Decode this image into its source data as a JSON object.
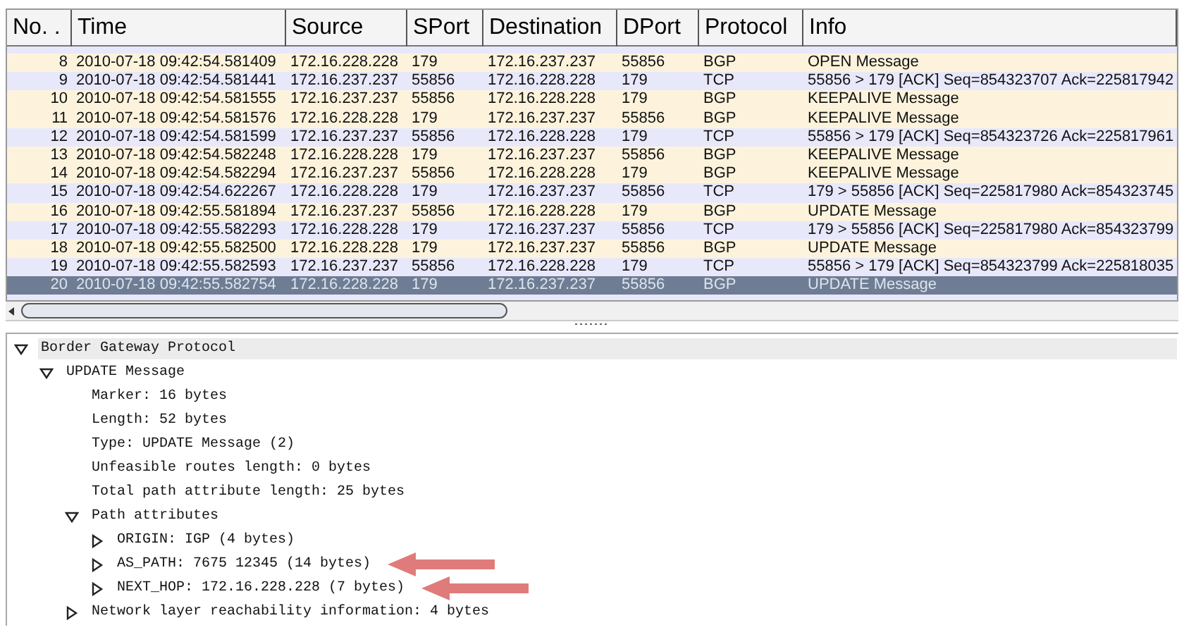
{
  "packet_list": {
    "columns": [
      "No. .",
      "Time",
      "Source",
      "SPort",
      "Destination",
      "DPort",
      "Protocol",
      "Info"
    ],
    "rows": [
      {
        "cells": [
          "8",
          "2010-07-18 09:42:54.581409",
          "172.16.228.228",
          "179",
          "172.16.237.237",
          "55856",
          "BGP",
          "OPEN Message"
        ],
        "color": "#fdf3dc",
        "selected": false
      },
      {
        "cells": [
          "9",
          "2010-07-18 09:42:54.581441",
          "172.16.237.237",
          "55856",
          "172.16.228.228",
          "179",
          "TCP",
          "55856 > 179 [ACK] Seq=854323707 Ack=225817942"
        ],
        "color": "#e8e8fb",
        "selected": false
      },
      {
        "cells": [
          "10",
          "2010-07-18 09:42:54.581555",
          "172.16.237.237",
          "55856",
          "172.16.228.228",
          "179",
          "BGP",
          "KEEPALIVE Message"
        ],
        "color": "#fdf3dc",
        "selected": false
      },
      {
        "cells": [
          "11",
          "2010-07-18 09:42:54.581576",
          "172.16.228.228",
          "179",
          "172.16.237.237",
          "55856",
          "BGP",
          "KEEPALIVE Message"
        ],
        "color": "#fdf3dc",
        "selected": false
      },
      {
        "cells": [
          "12",
          "2010-07-18 09:42:54.581599",
          "172.16.237.237",
          "55856",
          "172.16.228.228",
          "179",
          "TCP",
          "55856 > 179 [ACK] Seq=854323726 Ack=225817961"
        ],
        "color": "#e8e8fb",
        "selected": false
      },
      {
        "cells": [
          "13",
          "2010-07-18 09:42:54.582248",
          "172.16.228.228",
          "179",
          "172.16.237.237",
          "55856",
          "BGP",
          "KEEPALIVE Message"
        ],
        "color": "#fdf3dc",
        "selected": false
      },
      {
        "cells": [
          "14",
          "2010-07-18 09:42:54.582294",
          "172.16.237.237",
          "55856",
          "172.16.228.228",
          "179",
          "BGP",
          "KEEPALIVE Message"
        ],
        "color": "#fdf3dc",
        "selected": false
      },
      {
        "cells": [
          "15",
          "2010-07-18 09:42:54.622267",
          "172.16.228.228",
          "179",
          "172.16.237.237",
          "55856",
          "TCP",
          "179 > 55856 [ACK] Seq=225817980 Ack=854323745"
        ],
        "color": "#e8e8fb",
        "selected": false
      },
      {
        "cells": [
          "16",
          "2010-07-18 09:42:55.581894",
          "172.16.237.237",
          "55856",
          "172.16.228.228",
          "179",
          "BGP",
          "UPDATE Message"
        ],
        "color": "#fdf3dc",
        "selected": false
      },
      {
        "cells": [
          "17",
          "2010-07-18 09:42:55.582293",
          "172.16.228.228",
          "179",
          "172.16.237.237",
          "55856",
          "TCP",
          "179 > 55856 [ACK] Seq=225817980 Ack=854323799"
        ],
        "color": "#e8e8fb",
        "selected": false
      },
      {
        "cells": [
          "18",
          "2010-07-18 09:42:55.582500",
          "172.16.228.228",
          "179",
          "172.16.237.237",
          "55856",
          "BGP",
          "UPDATE Message"
        ],
        "color": "#fdf3dc",
        "selected": false
      },
      {
        "cells": [
          "19",
          "2010-07-18 09:42:55.582593",
          "172.16.237.237",
          "55856",
          "172.16.228.228",
          "179",
          "TCP",
          "55856 > 179 [ACK] Seq=854323799 Ack=225818035"
        ],
        "color": "#e8e8fb",
        "selected": false
      },
      {
        "cells": [
          "20",
          "2010-07-18 09:42:55.582754",
          "172.16.228.228",
          "179",
          "172.16.237.237",
          "55856",
          "BGP",
          "UPDATE Message"
        ],
        "color": "#6e7d93",
        "selected": true
      }
    ]
  },
  "packet_details": [
    {
      "label": "Border Gateway Protocol",
      "kind": "branch",
      "expanded": true,
      "selected": true,
      "highlighted": false,
      "children": [
        {
          "label": "UPDATE Message",
          "kind": "branch",
          "expanded": true,
          "selected": false,
          "highlighted": false,
          "children": [
            {
              "label": "Marker: 16 bytes",
              "kind": "leaf",
              "selected": false,
              "highlighted": false
            },
            {
              "label": "Length: 52 bytes",
              "kind": "leaf",
              "selected": false,
              "highlighted": false
            },
            {
              "label": "Type: UPDATE Message (2)",
              "kind": "leaf",
              "selected": false,
              "highlighted": false
            },
            {
              "label": "Unfeasible routes length: 0 bytes",
              "kind": "leaf",
              "selected": false,
              "highlighted": false
            },
            {
              "label": "Total path attribute length: 25 bytes",
              "kind": "leaf",
              "selected": false,
              "highlighted": false
            },
            {
              "label": "Path attributes",
              "kind": "branch",
              "expanded": true,
              "selected": false,
              "highlighted": false,
              "children": [
                {
                  "label": "ORIGIN: IGP (4 bytes)",
                  "kind": "branch",
                  "expanded": false,
                  "selected": false,
                  "highlighted": false
                },
                {
                  "label": "AS_PATH: 7675 12345 (14 bytes)",
                  "kind": "branch",
                  "expanded": false,
                  "selected": false,
                  "highlighted": true
                },
                {
                  "label": "NEXT_HOP: 172.16.228.228 (7 bytes)",
                  "kind": "branch",
                  "expanded": false,
                  "selected": false,
                  "highlighted": true
                }
              ]
            },
            {
              "label": "Network layer reachability information: 4 bytes",
              "kind": "branch",
              "expanded": false,
              "selected": false,
              "highlighted": false
            }
          ]
        }
      ]
    }
  ]
}
